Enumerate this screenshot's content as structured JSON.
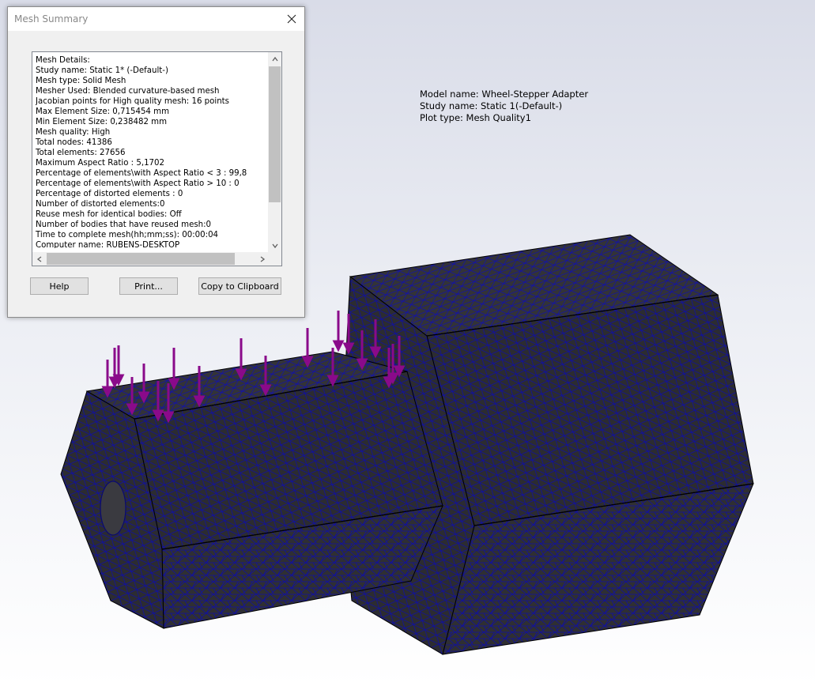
{
  "plot_info": {
    "model_name": "Model name: Wheel-Stepper Adapter",
    "study_name": "Study name: Static 1(-Default-)",
    "plot_type": "Plot type: Mesh Quality1"
  },
  "dialog": {
    "title": "Mesh Summary",
    "close_icon": "close-icon",
    "lines": [
      "Mesh Details:",
      "Study name: Static 1* (-Default-)",
      "Mesh type: Solid Mesh",
      "Mesher Used: Blended curvature-based mesh",
      "Jacobian points for High quality mesh: 16 points",
      "Max Element Size: 0,715454 mm",
      "Min Element Size: 0,238482 mm",
      "Mesh quality: High",
      "Total nodes: 41386",
      "Total elements: 27656",
      "Maximum Aspect Ratio : 5,1702",
      "Percentage of elements\\with Aspect Ratio < 3 : 99,8",
      "Percentage of elements\\with Aspect Ratio > 10 : 0",
      "Percentage of distorted elements : 0",
      "Number of distorted elements:0",
      "Reuse mesh for identical bodies: Off",
      "Number of bodies that have reused mesh:0",
      "Time to complete mesh(hh;mm;ss): 00:00:04",
      "Computer name: RUBENS-DESKTOP"
    ],
    "buttons": {
      "help": "Help",
      "print": "Print...",
      "copy": "Copy to Clipboard"
    }
  },
  "colors": {
    "mesh_fill": "#2f2f33",
    "mesh_edges": "#0a0a8c",
    "load_arrows": "#8a0a8a"
  }
}
